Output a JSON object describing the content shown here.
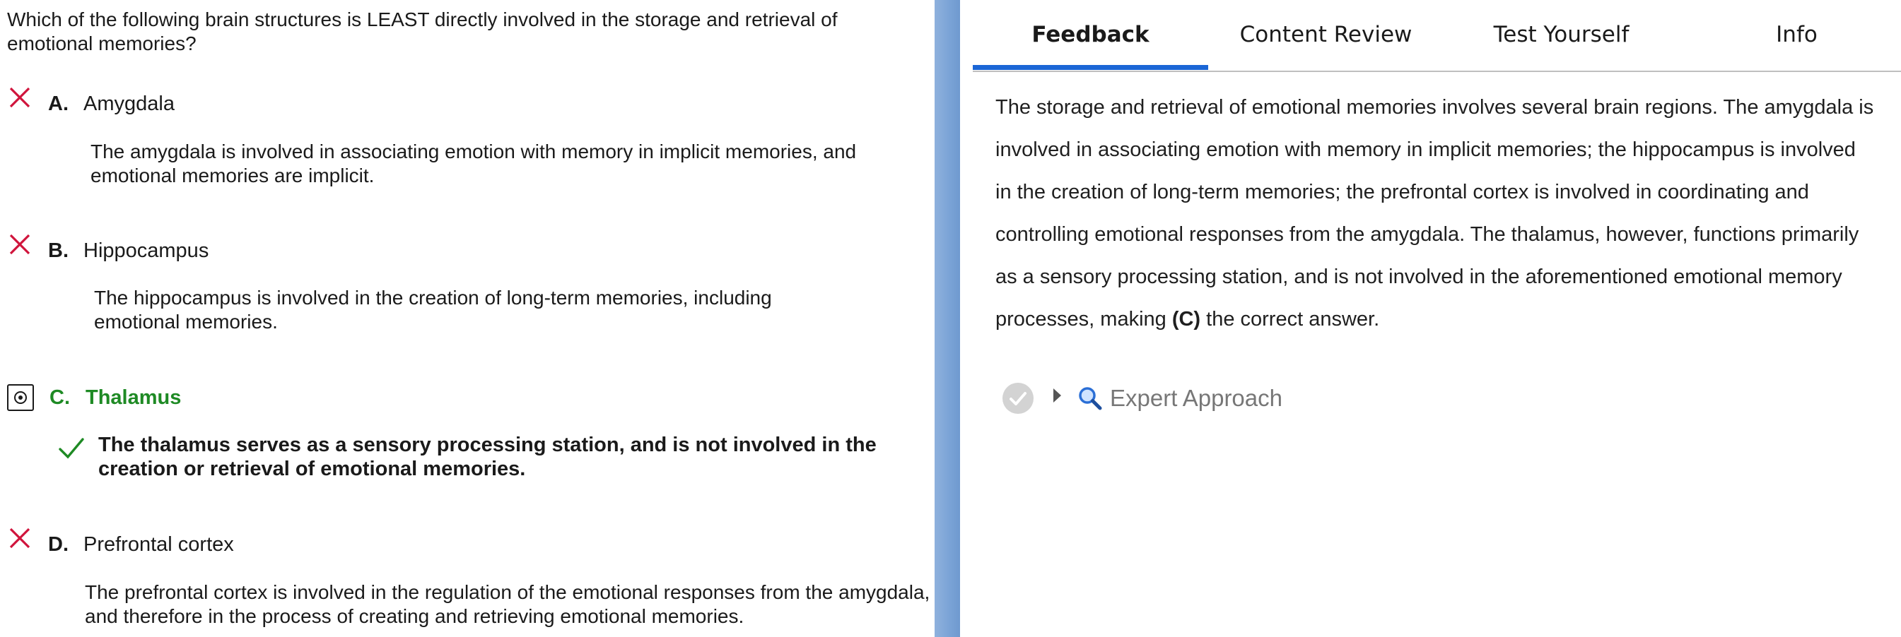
{
  "question": {
    "text": "Which of the following brain structures is LEAST directly involved in the storage and retrieval of emotional memories?"
  },
  "options": [
    {
      "letter": "A.",
      "label": "Amygdala",
      "status": "incorrect",
      "explanation": "The amygdala is involved in associating emotion with memory in implicit memories, and emotional memories are implicit."
    },
    {
      "letter": "B.",
      "label": "Hippocampus",
      "status": "incorrect",
      "explanation": "The hippocampus is involved in the creation of long-term memories, including emotional memories."
    },
    {
      "letter": "C.",
      "label": "Thalamus",
      "status": "selected-correct",
      "explanation": "The thalamus serves as a sensory processing station, and is not involved in the creation or retrieval of emotional memories."
    },
    {
      "letter": "D.",
      "label": "Prefrontal cortex",
      "status": "incorrect",
      "explanation": "The prefrontal cortex is involved in the regulation of the emotional responses from the amygdala, and therefore in the process of creating and retrieving emotional memories."
    }
  ],
  "tabs": [
    {
      "label": "Feedback",
      "active": true
    },
    {
      "label": "Content Review",
      "active": false
    },
    {
      "label": "Test Yourself",
      "active": false
    },
    {
      "label": "Info",
      "active": false
    }
  ],
  "feedback": {
    "text_before": "The storage and retrieval of emotional memories involves several brain regions. The amygdala is involved in associating emotion with memory in implicit memories; the hippocampus is involved in the creation of long-term memories; the prefrontal cortex is involved in coordinating and controlling emotional responses from the amygdala. The thalamus, however, functions primarily as a sensory processing station, and is not involved in the aforementioned emotional memory processes, making ",
    "answer_ref": "(C)",
    "text_after": " the correct answer."
  },
  "expert_approach": {
    "label": "Expert Approach",
    "icons": [
      "check-circle-icon",
      "caret-right-icon",
      "magnifier-icon"
    ]
  },
  "colors": {
    "incorrect_mark": "#d0143c",
    "correct_green": "#1e8a24",
    "tab_underline": "#1b66d6",
    "splitter": "#7aa3d6"
  }
}
